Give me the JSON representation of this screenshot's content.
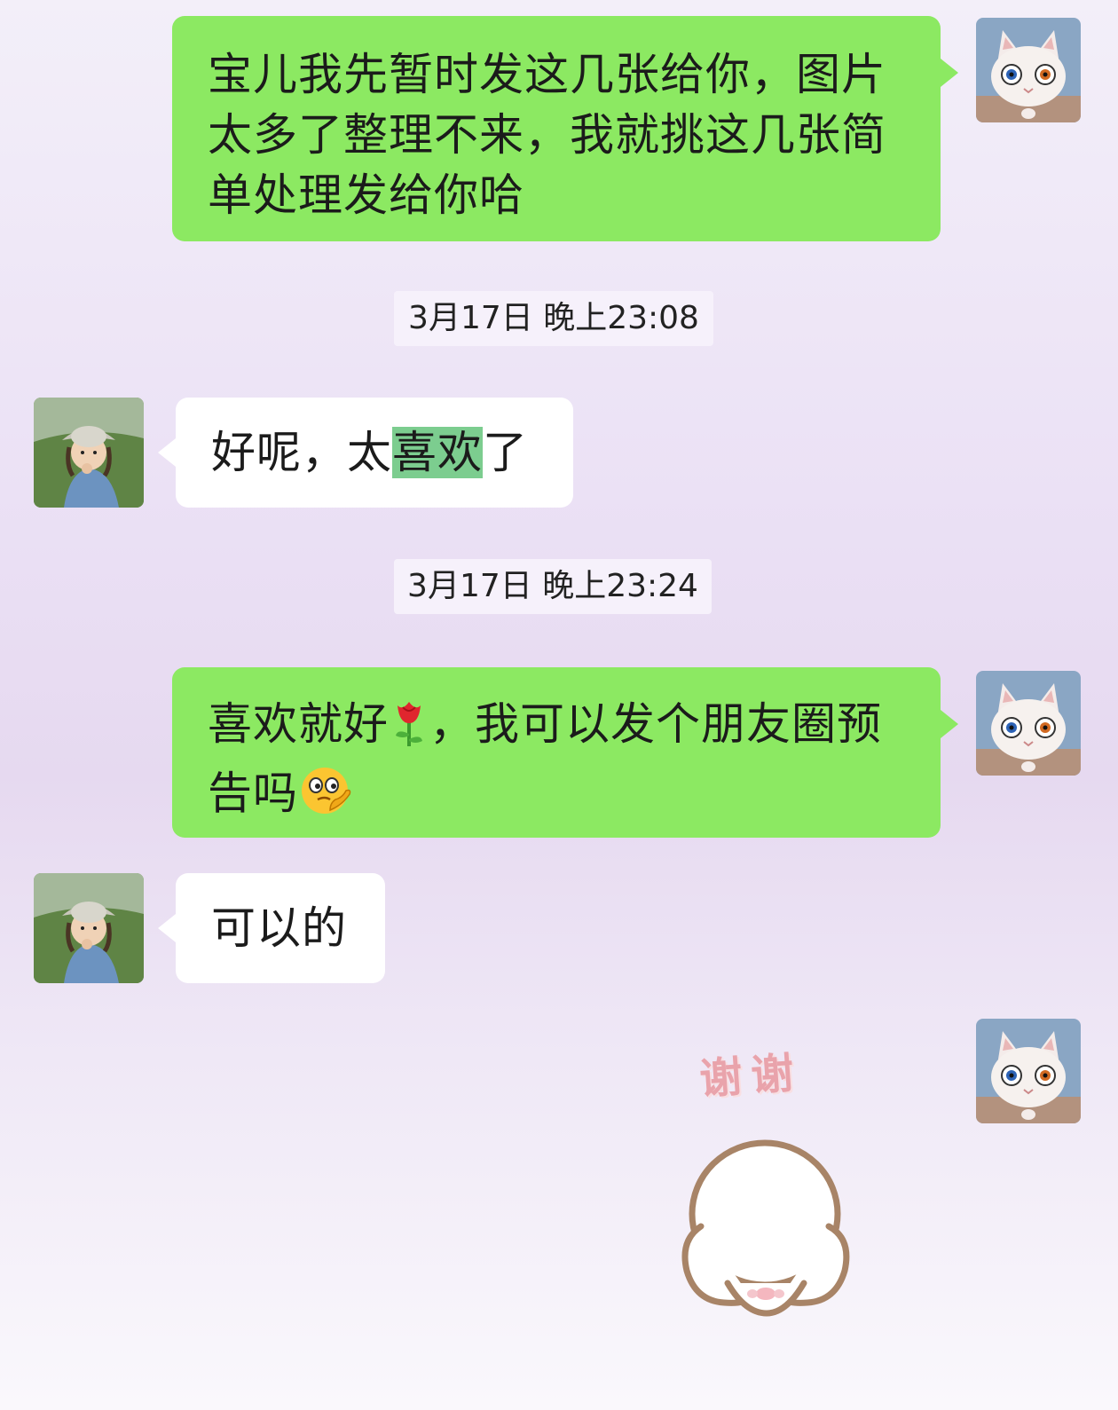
{
  "messages": [
    {
      "side": "me",
      "text": "宝儿我先暂时发这几张给你，图片太多了整理不来，我就挑这几张简单处理发给你哈"
    },
    {
      "type": "timestamp",
      "text": "3月17日 晚上23:08"
    },
    {
      "side": "them",
      "text_before": "好呢，太",
      "text_highlight": "喜欢",
      "text_after": "了"
    },
    {
      "type": "timestamp",
      "text": "3月17日 晚上23:24"
    },
    {
      "side": "me",
      "text_part1": "喜欢就好",
      "text_part2": "，我可以发个朋友圈预告吗",
      "emoji1": "rose-emoji",
      "emoji2": "thinking-emoji"
    },
    {
      "side": "them",
      "text": "可以的"
    },
    {
      "side": "me",
      "type": "sticker",
      "sticker_text": "谢谢",
      "sticker_name": "thank-you-sticker"
    }
  ],
  "avatars": {
    "me": "cat-avatar",
    "them": "child-avatar"
  },
  "colors": {
    "my_bubble": "#8ce962",
    "their_bubble": "#ffffff",
    "highlight": "#7ccd8f",
    "timestamp_bg": "#f6f1fb"
  }
}
